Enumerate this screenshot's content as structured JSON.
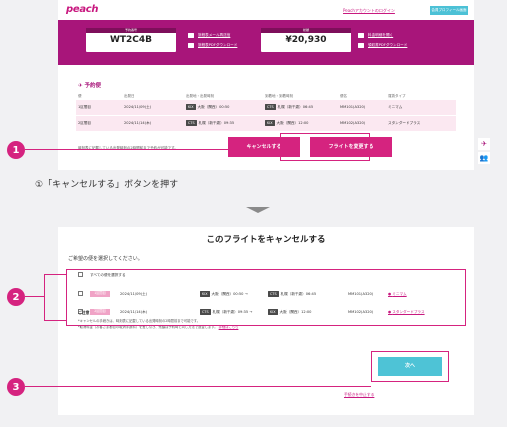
{
  "header": {
    "logo": "peach",
    "account_link": "Peachアカウントのログイン",
    "top_button": "会員プロフィール画面"
  },
  "booking": {
    "code_label": "予約番号",
    "code": "WT2C4B",
    "amount_label": "総額",
    "amount": "¥20,930",
    "links": [
      "旅程表メール再送信",
      "旅程表PDFダウンロード",
      "料金明細を開く",
      "領収書PDFダウンロード"
    ]
  },
  "reservation": {
    "title": "予約便",
    "columns": [
      "便",
      "出発日",
      "出発地・出発時刻",
      "到着地・到着時刻",
      "便名",
      "運賃タイプ"
    ],
    "rows": [
      {
        "leg": "1区間目",
        "date": "2024/11/09(土)",
        "from_code": "KIX",
        "from": "大阪（関西）00:50",
        "to_code": "CTS",
        "to": "札幌（新千歳）06:45",
        "flight": "MM101(A320)",
        "fare": "ミニマム"
      },
      {
        "leg": "2区間目",
        "date": "2024/11/14(木)",
        "from_code": "CTS",
        "from": "札幌（新千歳）09:35",
        "to_code": "KIX",
        "to": "大阪（関西）12:00",
        "flight": "MM102(A320)",
        "fare": "スタンダードプラス"
      }
    ],
    "note": "時刻表に記載している出発時刻の2時間前まで予約が可能です。",
    "cancel_button": "キャンセルする",
    "change_button": "フライトを変更する"
  },
  "steps": {
    "step1_circle": "1",
    "step1_text": "①「キャンセルする」ボタンを押す",
    "step2_circle": "2",
    "step3_circle": "3"
  },
  "cancel_page": {
    "title": "このフライトをキャンセルする",
    "instruction": "ご希望の便を選択してください。",
    "select_all": "すべての便を選択する",
    "rows": [
      {
        "tag": "1区間目",
        "date": "2024/11/09(土)",
        "from_code": "KIX",
        "from": "大阪（関西）00:50 →",
        "to_code": "CTS",
        "to": "札幌（新千歳）06:45",
        "flight": "MM101(A320)",
        "fare": "ミニマム"
      },
      {
        "tag": "2区間目",
        "date": "2024/11/14(木)",
        "from_code": "CTS",
        "from": "札幌（新千歳）09:35 →",
        "to_code": "KIX",
        "to": "大阪（関西）12:00",
        "flight": "MM102(A320)",
        "fare": "スタンダードプラス"
      }
    ],
    "notes_heading": "ご注意",
    "notes": [
      "*キャンセルの手続きは、時刻表に記載している出発時刻の2時間前まで可能です。",
      "*取消料金（お客さま都合の取消手数料）を差し引き、残額は予約時と同じ方法で返金します。",
      "詳細はこちら"
    ],
    "next_button": "次へ",
    "cancel_link": "手続きを中止する"
  },
  "colors": {
    "brand": "#a8157a",
    "accent": "#d5237f",
    "cta": "#4ec3d6"
  }
}
